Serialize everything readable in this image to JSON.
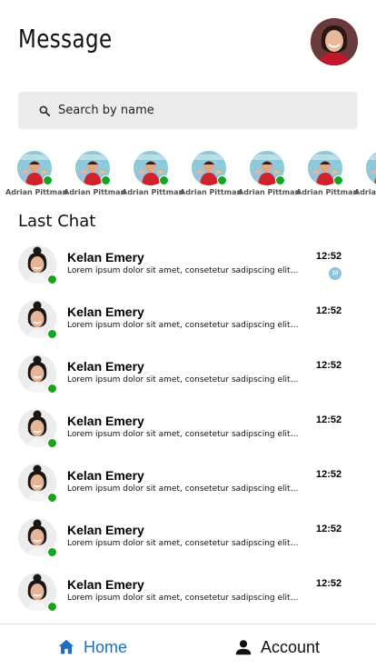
{
  "header": {
    "title": "Message",
    "profile_avatar": "profile-photo"
  },
  "search": {
    "placeholder": "Search by name",
    "icon": "search-icon"
  },
  "stories": [
    {
      "name": "Adrian Pittman",
      "online": true
    },
    {
      "name": "Adrian Pittman",
      "online": true
    },
    {
      "name": "Adrian Pittman",
      "online": true
    },
    {
      "name": "Adrian Pittman",
      "online": true
    },
    {
      "name": "Adrian Pittman",
      "online": true
    },
    {
      "name": "Adrian Pittman",
      "online": true
    },
    {
      "name": "Adrian Pittman",
      "online": true
    }
  ],
  "last_chat": {
    "title": "Last Chat",
    "chats": [
      {
        "name": "Kelan Emery",
        "preview": "Lorem ipsum dolor sit amet, consetetur sadipscing elitr, sed diam nonumy",
        "time": "12:52",
        "unread": "10",
        "online": true
      },
      {
        "name": "Kelan Emery",
        "preview": "Lorem ipsum dolor sit amet, consetetur sadipscing elitr, sed diam nonumy",
        "time": "12:52",
        "unread": "",
        "online": true
      },
      {
        "name": "Kelan Emery",
        "preview": "Lorem ipsum dolor sit amet, consetetur sadipscing elitr, sed diam nonumy",
        "time": "12:52",
        "unread": "",
        "online": true
      },
      {
        "name": "Kelan Emery",
        "preview": "Lorem ipsum dolor sit amet, consetetur sadipscing elitr, sed diam nonumy",
        "time": "12:52",
        "unread": "",
        "online": true
      },
      {
        "name": "Kelan Emery",
        "preview": "Lorem ipsum dolor sit amet, consetetur sadipscing elitr, sed diam nonumy",
        "time": "12:52",
        "unread": "",
        "online": true
      },
      {
        "name": "Kelan Emery",
        "preview": "Lorem ipsum dolor sit amet, consetetur sadipscing elitr, sed diam nonumy",
        "time": "12:52",
        "unread": "",
        "online": true
      },
      {
        "name": "Kelan Emery",
        "preview": "Lorem ipsum dolor sit amet, consetetur sadipscing elitr, sed diam nonumy",
        "time": "12:52",
        "unread": "",
        "online": true
      }
    ]
  },
  "bottom_nav": {
    "home": {
      "label": "Home",
      "icon": "home-icon",
      "active": true
    },
    "account": {
      "label": "Account",
      "icon": "person-icon",
      "active": false
    }
  },
  "colors": {
    "accent": "#1e6fbf",
    "online": "#16a51c",
    "badge": "#8fc1d9",
    "search_bg": "#ececec"
  }
}
